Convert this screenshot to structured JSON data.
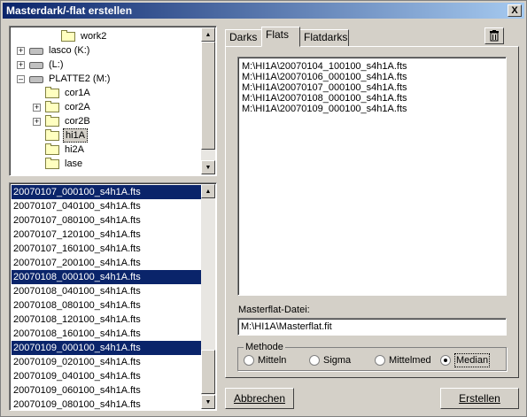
{
  "window": {
    "title": "Masterdark/-flat erstellen",
    "close_label": "X"
  },
  "tree": {
    "items": [
      {
        "label": "work2",
        "kind": "folder",
        "indent": 3,
        "selected": false,
        "expander": ""
      },
      {
        "label": "lasco (K:)",
        "kind": "drive",
        "indent": 1,
        "selected": false,
        "expander": "+"
      },
      {
        "label": "(L:)",
        "kind": "drive",
        "indent": 1,
        "selected": false,
        "expander": "+"
      },
      {
        "label": "PLATTE2 (M:)",
        "kind": "drive",
        "indent": 1,
        "selected": false,
        "expander": "-"
      },
      {
        "label": "cor1A",
        "kind": "folder",
        "indent": 2,
        "selected": false,
        "expander": ""
      },
      {
        "label": "cor2A",
        "kind": "folder",
        "indent": 2,
        "selected": false,
        "expander": "+"
      },
      {
        "label": "cor2B",
        "kind": "folder",
        "indent": 2,
        "selected": false,
        "expander": "+"
      },
      {
        "label": "hi1A",
        "kind": "folder",
        "indent": 2,
        "selected": true,
        "expander": ""
      },
      {
        "label": "hi2A",
        "kind": "folder",
        "indent": 2,
        "selected": false,
        "expander": ""
      },
      {
        "label": "lase",
        "kind": "folder",
        "indent": 2,
        "selected": false,
        "expander": ""
      }
    ]
  },
  "files": {
    "items": [
      {
        "name": "20070107_000100_s4h1A.fts",
        "selected": true
      },
      {
        "name": "20070107_040100_s4h1A.fts",
        "selected": false
      },
      {
        "name": "20070107_080100_s4h1A.fts",
        "selected": false
      },
      {
        "name": "20070107_120100_s4h1A.fts",
        "selected": false
      },
      {
        "name": "20070107_160100_s4h1A.fts",
        "selected": false
      },
      {
        "name": "20070107_200100_s4h1A.fts",
        "selected": false
      },
      {
        "name": "20070108_000100_s4h1A.fts",
        "selected": true
      },
      {
        "name": "20070108_040100_s4h1A.fts",
        "selected": false
      },
      {
        "name": "20070108_080100_s4h1A.fts",
        "selected": false
      },
      {
        "name": "20070108_120100_s4h1A.fts",
        "selected": false
      },
      {
        "name": "20070108_160100_s4h1A.fts",
        "selected": false
      },
      {
        "name": "20070109_000100_s4h1A.fts",
        "selected": true
      },
      {
        "name": "20070109_020100_s4h1A.fts",
        "selected": false
      },
      {
        "name": "20070109_040100_s4h1A.fts",
        "selected": false
      },
      {
        "name": "20070109_060100_s4h1A.fts",
        "selected": false
      },
      {
        "name": "20070109_080100_s4h1A.fts",
        "selected": false
      }
    ]
  },
  "tabs": [
    {
      "label": "Darks",
      "active": false
    },
    {
      "label": "Flats",
      "active": true
    },
    {
      "label": "Flatdarks",
      "active": false
    }
  ],
  "flats": [
    "M:\\HI1A\\20070104_100100_s4h1A.fts",
    "M:\\HI1A\\20070106_000100_s4h1A.fts",
    "M:\\HI1A\\20070107_000100_s4h1A.fts",
    "M:\\HI1A\\20070108_000100_s4h1A.fts",
    "M:\\HI1A\\20070109_000100_s4h1A.fts"
  ],
  "masterflat": {
    "label": "Masterflat-Datei:",
    "value": "M:\\HI1A\\Masterflat.fit"
  },
  "method": {
    "label": "Methode",
    "options": [
      {
        "label": "Mitteln",
        "checked": false
      },
      {
        "label": "Sigma",
        "checked": false
      },
      {
        "label": "Mittelmed",
        "checked": false
      },
      {
        "label": "Median",
        "checked": true
      }
    ]
  },
  "buttons": {
    "cancel": "Abbrechen",
    "create": "Erstellen"
  },
  "icons": {
    "delete": "trash-icon",
    "close": "close-icon"
  }
}
